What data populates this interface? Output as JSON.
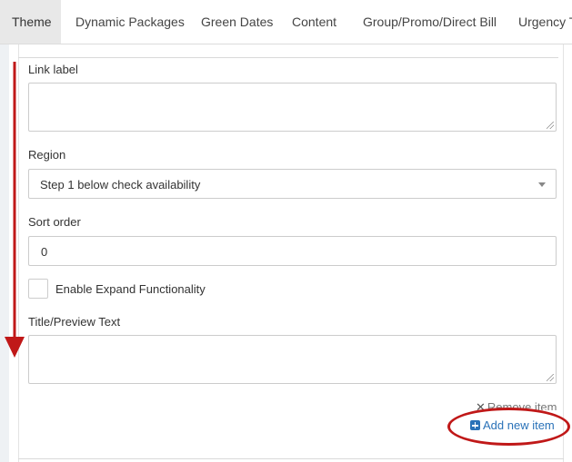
{
  "tabs": [
    {
      "label": "Theme",
      "active": true
    },
    {
      "label": "Dynamic Packages",
      "active": false
    },
    {
      "label": "Green Dates",
      "active": false
    },
    {
      "label": "Content",
      "active": false
    },
    {
      "label": "Group/Promo/Direct Bill",
      "active": false
    },
    {
      "label": "Urgency T",
      "active": false
    }
  ],
  "form": {
    "link_label": {
      "label": "Link label",
      "value": ""
    },
    "region": {
      "label": "Region",
      "value": "Step 1 below check availability"
    },
    "sort_order": {
      "label": "Sort order",
      "value": "0"
    },
    "expand": {
      "label": "Enable Expand Functionality",
      "checked": false
    },
    "title_preview": {
      "label": "Title/Preview Text",
      "value": ""
    }
  },
  "actions": {
    "remove_item": "Remove item",
    "add_new_item": "Add new item"
  },
  "icons": {
    "remove": "close-icon",
    "add": "plus-square-icon",
    "select_caret": "caret-down-icon"
  },
  "colors": {
    "link": "#2a72b8",
    "annotation": "#c01818",
    "active_tab": "#e8e8e8"
  }
}
